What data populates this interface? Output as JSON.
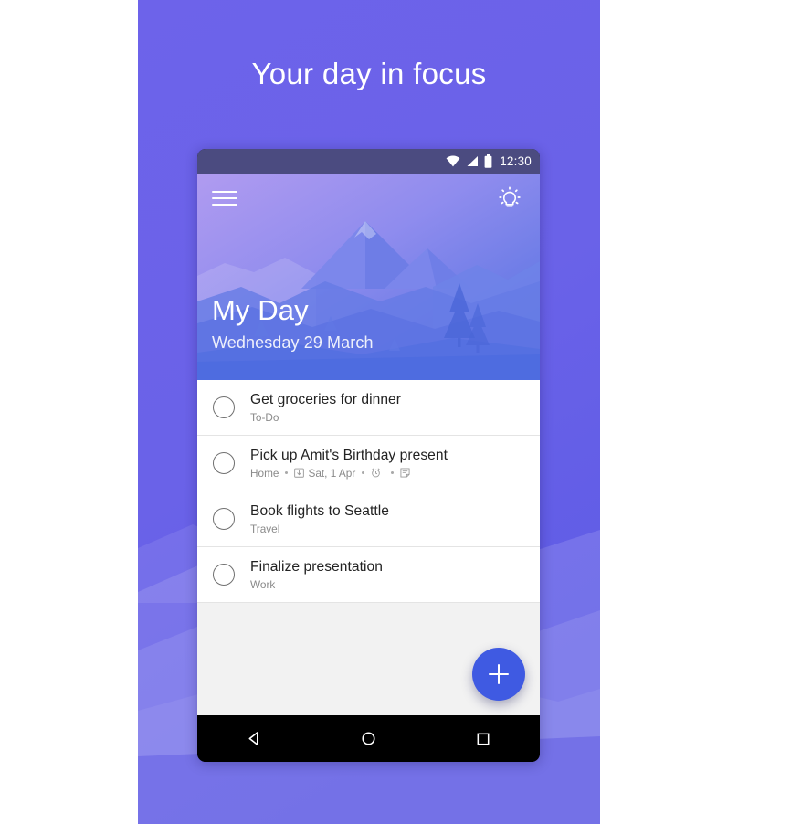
{
  "promo": {
    "title": "Your day in focus",
    "background_color": "#6a62e8"
  },
  "phone": {
    "status_bar": {
      "clock": "12:30",
      "background_color": "#4b4b80",
      "icons": [
        "wifi-icon",
        "cellular-signal-icon",
        "battery-icon"
      ]
    },
    "app_bar": {
      "menu_icon": "hamburger-menu-icon",
      "suggestions_icon": "lightbulb-icon"
    },
    "hero": {
      "title": "My Day",
      "subtitle": "Wednesday 29 March"
    },
    "tasks": [
      {
        "title": "Get groceries for dinner",
        "list": "To-Do",
        "due": "",
        "has_calendar": false,
        "has_reminder": false,
        "has_note": false,
        "completed": false
      },
      {
        "title": "Pick up Amit's Birthday present",
        "list": "Home",
        "due": "Sat, 1 Apr",
        "has_calendar": true,
        "has_reminder": true,
        "has_note": true,
        "completed": false
      },
      {
        "title": "Book flights to Seattle",
        "list": "Travel",
        "due": "",
        "has_calendar": false,
        "has_reminder": false,
        "has_note": false,
        "completed": false
      },
      {
        "title": "Finalize presentation",
        "list": "Work",
        "due": "",
        "has_calendar": false,
        "has_reminder": false,
        "has_note": false,
        "completed": false
      }
    ],
    "fab": {
      "label": "+",
      "icon": "plus-icon",
      "color": "#3f5ae2"
    },
    "nav_bar": {
      "back_icon": "triangle-back-icon",
      "home_icon": "circle-home-icon",
      "recents_icon": "square-recents-icon"
    }
  }
}
